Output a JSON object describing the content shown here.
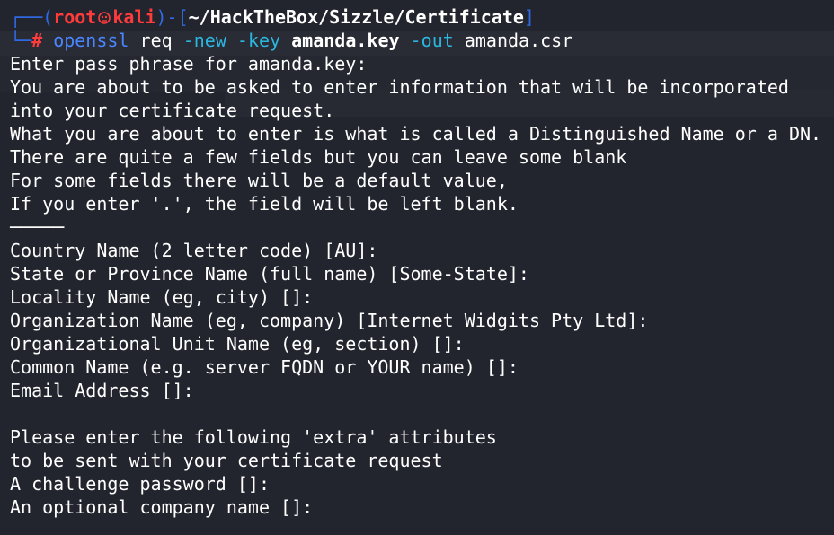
{
  "prompt": {
    "open_bracket": "┌──(",
    "user": "root",
    "host": "kali",
    "close_bracket": ")-[",
    "cwd": "~/HackTheBox/Sizzle/Certificate",
    "end_bracket": "]",
    "second_line_prefix": "└─",
    "hash": "#"
  },
  "command": {
    "program": "openssl",
    "subcommand": "req",
    "flag_new": "-new",
    "flag_key": "-key",
    "key_file": "amanda.key",
    "flag_out": "-out",
    "out_file": "amanda.csr"
  },
  "output_lines": [
    "Enter pass phrase for amanda.key:",
    "You are about to be asked to enter information that will be incorporated",
    "into your certificate request.",
    "What you are about to enter is what is called a Distinguished Name or a DN.",
    "There are quite a few fields but you can leave some blank",
    "For some fields there will be a default value,",
    "If you enter '.', the field will be left blank.",
    "─────",
    "Country Name (2 letter code) [AU]:",
    "State or Province Name (full name) [Some-State]:",
    "Locality Name (eg, city) []:",
    "Organization Name (eg, company) [Internet Widgits Pty Ltd]:",
    "Organizational Unit Name (eg, section) []:",
    "Common Name (e.g. server FQDN or YOUR name) []:",
    "Email Address []:",
    "",
    "Please enter the following 'extra' attributes",
    "to be sent with your certificate request",
    "A challenge password []:",
    "An optional company name []:"
  ]
}
